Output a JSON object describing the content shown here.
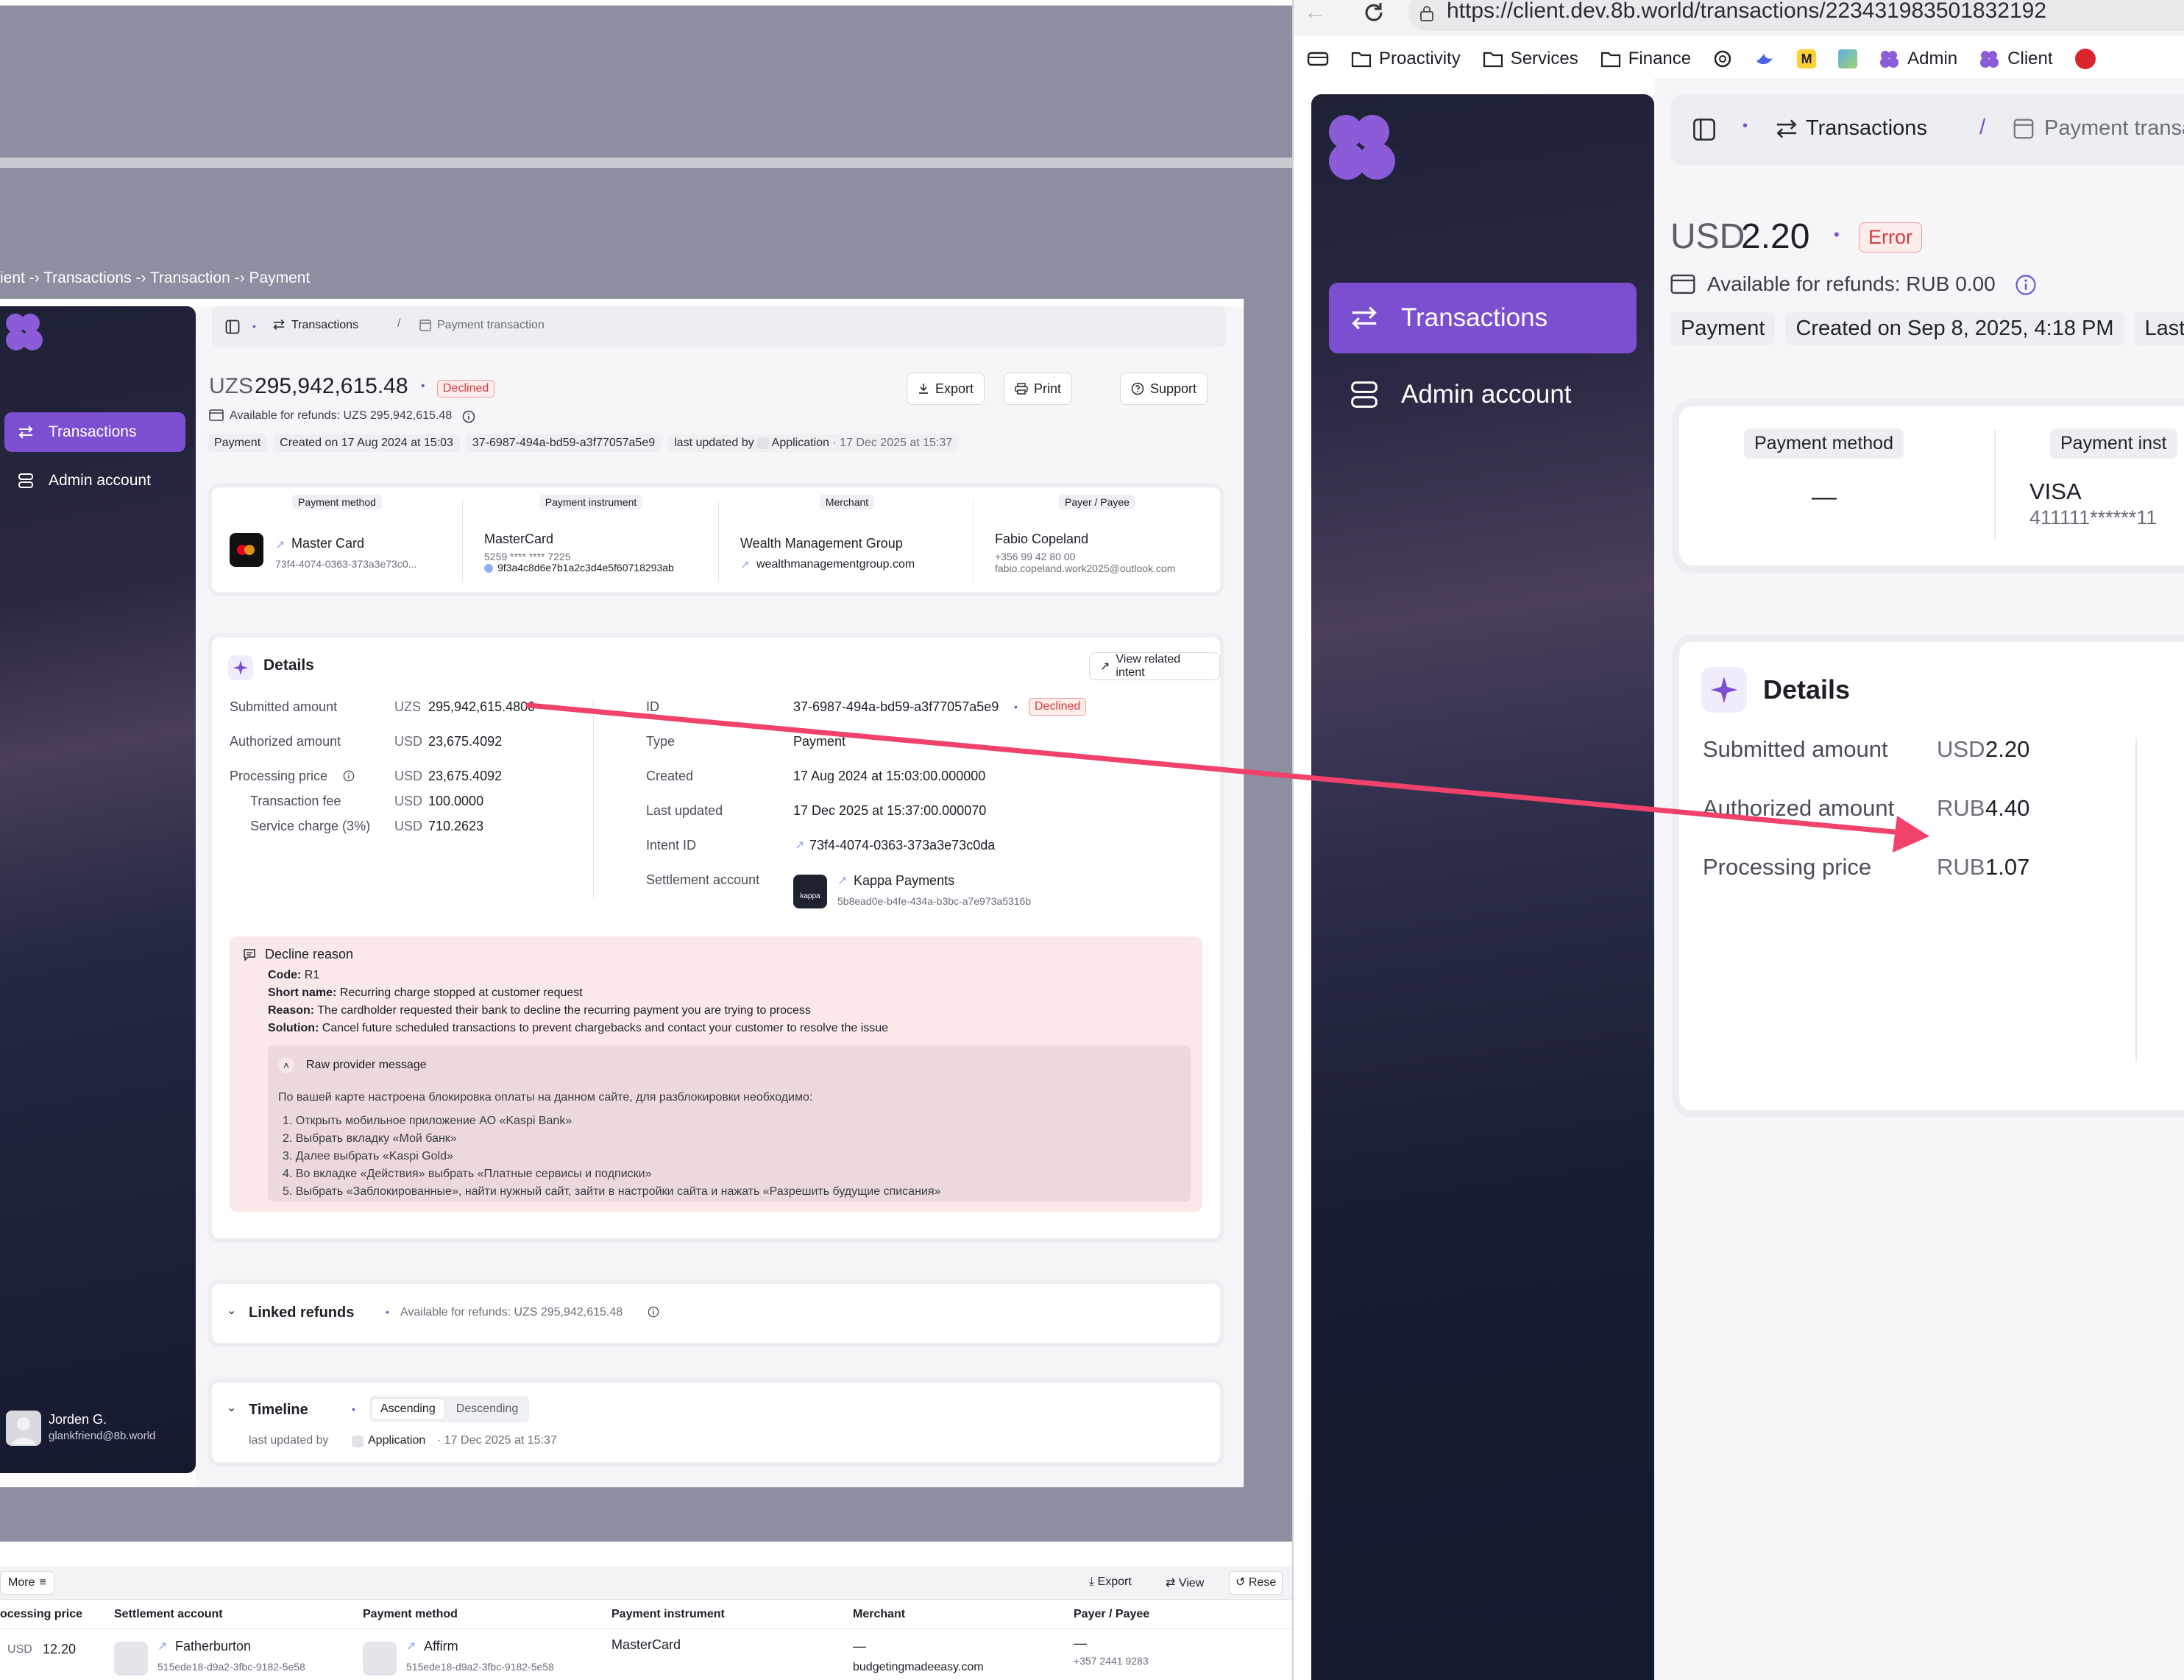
{
  "left": {
    "breadcrumb": "ient -› Transactions -› Transaction -› Payment",
    "sidebar": {
      "items": [
        {
          "label": "Transactions",
          "icon": "arrows-swap-icon",
          "active": true
        },
        {
          "label": "Admin account",
          "icon": "server-icon",
          "active": false
        }
      ],
      "user": {
        "name": "Jorden G.",
        "email": "glankfriend@8b.world"
      }
    },
    "topbar": {
      "transactions": "Transactions",
      "separator": "/",
      "payment_transaction": "Payment transaction"
    },
    "header": {
      "currency": "UZS",
      "amount": "295,942,615.48",
      "status": "Declined",
      "refunds": "Available for refunds: UZS 295,942,615.48",
      "pills": [
        "Payment",
        "Created on 17 Aug 2024 at 15:03",
        "37-6987-494a-bd59-a3f77057a5e9"
      ],
      "last_updated_by": "last updated by",
      "updater": "Application",
      "updated_at": "· 17 Dec 2025 at 15:37",
      "export": "Export",
      "print": "Print",
      "support": "Support"
    },
    "summary": {
      "payment_method": {
        "head": "Payment method",
        "name": "Master Card",
        "id": "73f4-4074-0363-373a3e73c0..."
      },
      "payment_instrument": {
        "head": "Payment instrument",
        "name": "MasterCard",
        "mask": "5259 **** **** 7225",
        "id": "9f3a4c8d6e7b1a2c3d4e5f60718293ab"
      },
      "merchant": {
        "head": "Merchant",
        "name": "Wealth Management Group",
        "link": "wealthmanagementgroup.com"
      },
      "payer": {
        "head": "Payer / Payee",
        "name": "Fabio Copeland",
        "phone": "+356 99 42 80 00",
        "email": "fabio.copeland.work2025@outlook.com"
      }
    },
    "details": {
      "title": "Details",
      "view_intent": "View related intent",
      "left_rows": [
        {
          "label": "Submitted amount",
          "cur": "UZS",
          "val": "295,942,615.4800"
        },
        {
          "label": "Authorized amount",
          "cur": "USD",
          "val": "23,675.4092"
        },
        {
          "label": "Processing price",
          "cur": "USD",
          "val": "23,675.4092"
        },
        {
          "label": "Transaction fee",
          "cur": "USD",
          "val": "100.0000"
        },
        {
          "label": "Service charge (3%)",
          "cur": "USD",
          "val": "710.2623"
        }
      ],
      "right_rows": [
        {
          "label": "ID",
          "val": "37-6987-494a-bd59-a3f77057a5e9"
        },
        {
          "label": "Type",
          "val": "Payment"
        },
        {
          "label": "Created",
          "val": "17 Aug 2024 at 15:03:00.000000"
        },
        {
          "label": "Last updated",
          "val": "17 Dec 2025 at 15:37:00.000070"
        },
        {
          "label": "Intent ID",
          "val": "73f4-4074-0363-373a3e73c0da"
        },
        {
          "label": "Settlement account",
          "val": "Kappa Payments"
        }
      ],
      "id_status": "Declined",
      "settlement_id": "5b8ead0e-b4fe-434a-b3bc-a7e973a5316b",
      "kappa_logo": "kappa"
    },
    "decline": {
      "title": "Decline reason",
      "code_label": "Code:",
      "code": "R1",
      "short_label": "Short name:",
      "short": "Recurring charge stopped at customer request",
      "reason_label": "Reason:",
      "reason": "The cardholder requested their bank to decline the recurring payment you are trying to process",
      "solution_label": "Solution:",
      "solution": "Cancel future scheduled transactions to prevent chargebacks and contact your customer to resolve the issue",
      "raw_title": "Raw provider message",
      "raw_intro": "По вашей карте настроена блокировка оплаты на данном сайте, для разблокировки необходимо:",
      "raw_steps": [
        "1. Открыть мобильное приложение АО «Kaspi Bank»",
        "2. Выбрать вкладку «Мой банк»",
        "3. Далее выбрать «Kaspi Gold»",
        "4. Во вкладке «Действия» выбрать «Платные сервисы и подписки»",
        "5. Выбрать «Заблокированные», найти нужный сайт, зайти в настройки сайта и нажать «Разрешить будущие списания»"
      ]
    },
    "linked_refunds": {
      "title": "Linked refunds",
      "refunds": "Available for refunds: UZS 295,942,615.48"
    },
    "timeline": {
      "title": "Timeline",
      "asc": "Ascending",
      "desc": "Descending",
      "last_updated_by": "last updated by",
      "updater": "Application",
      "updated_at": "· 17 Dec 2025 at 15:37"
    },
    "bottom": {
      "more": "More",
      "export": "Export",
      "view": "View",
      "reset": "Rese",
      "columns": [
        "ocessing price",
        "Settlement account",
        "Payment method",
        "Payment instrument",
        "Merchant",
        "Payer / Payee"
      ],
      "row": {
        "price_cur": "USD",
        "price": "12.20",
        "settlement": "Fatherburton",
        "settlement_id": "515ede18-d9a2-3fbc-9182-5e58",
        "method": "Affirm",
        "method_id": "515ede18-d9a2-3fbc-9182-5e58",
        "instrument": "MasterCard",
        "merchant": "—",
        "merchant_link": "budgetingmadeeasy.com",
        "payer": "—",
        "payer_phone": "+357 2441 9283"
      }
    }
  },
  "right": {
    "browser": {
      "url": "https://client.dev.8b.world/transactions/223431983501832192"
    },
    "bookmarks": [
      "Proactivity",
      "Services",
      "Finance",
      "Admin",
      "Client"
    ],
    "sidebar": {
      "items": [
        {
          "label": "Transactions",
          "icon": "arrows-swap-icon",
          "active": true
        },
        {
          "label": "Admin account",
          "icon": "server-icon",
          "active": false
        }
      ]
    },
    "topbar": {
      "transactions": "Transactions",
      "separator": "/",
      "payment_transaction": "Payment transac"
    },
    "header": {
      "currency": "USD",
      "amount": "2.20",
      "status": "Error",
      "refunds": "Available for refunds: RUB 0.00",
      "pills": [
        "Payment",
        "Created on Sep 8, 2025, 4:18 PM",
        "Last u"
      ]
    },
    "summary": {
      "payment_method": {
        "head": "Payment method",
        "value": "—"
      },
      "payment_instrument": {
        "head": "Payment inst",
        "name": "VISA",
        "mask": "411111******11"
      }
    },
    "details": {
      "title": "Details",
      "rows": [
        {
          "label": "Submitted amount",
          "cur": "USD",
          "val": "2.20"
        },
        {
          "label": "Authorized amount",
          "cur": "RUB",
          "val": "4.40"
        },
        {
          "label": "Processing price",
          "cur": "RUB",
          "val": "1.07"
        }
      ]
    }
  },
  "colors": {
    "accent": "#7c4fd1",
    "arrow": "#f0426a",
    "declined": "#d93c3c"
  }
}
